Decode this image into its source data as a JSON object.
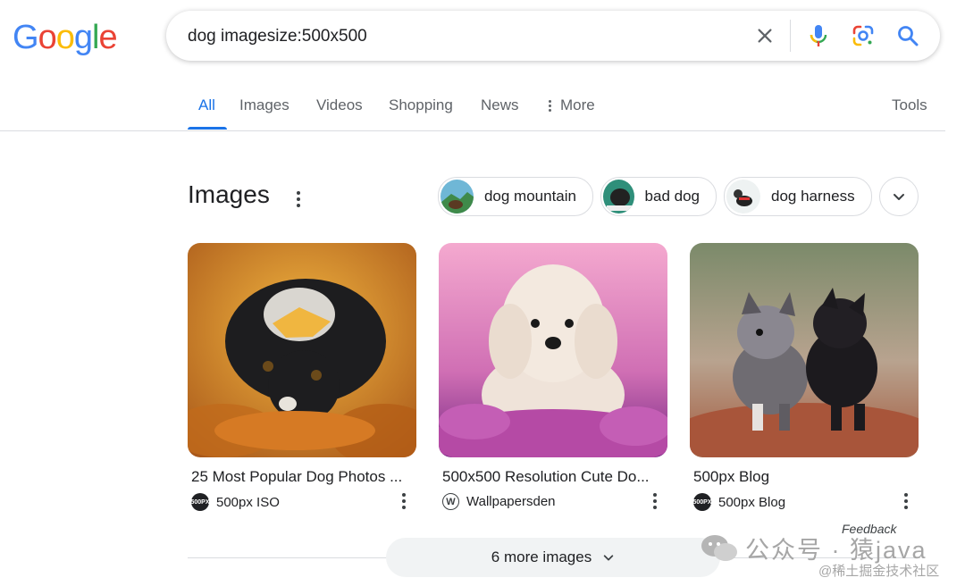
{
  "logo": {
    "letters": [
      "G",
      "o",
      "o",
      "g",
      "l",
      "e"
    ],
    "colors": [
      "#4285F4",
      "#EA4335",
      "#FBBC05",
      "#4285F4",
      "#34A853",
      "#EA4335"
    ]
  },
  "search": {
    "query": "dog imagesize:500x500"
  },
  "tabs": [
    {
      "label": "All",
      "active": true
    },
    {
      "label": "Images"
    },
    {
      "label": "Videos"
    },
    {
      "label": "Shopping"
    },
    {
      "label": "News"
    },
    {
      "label": "More"
    }
  ],
  "tools_label": "Tools",
  "images_section": {
    "title": "Images",
    "chips": [
      {
        "label": "dog mountain"
      },
      {
        "label": "bad dog"
      },
      {
        "label": "dog harness"
      }
    ],
    "results": [
      {
        "title": "25 Most Popular Dog Photos ...",
        "source": "500px ISO",
        "favicon_text": "500PX"
      },
      {
        "title": "500x500 Resolution Cute Do...",
        "source": "Wallpapersden",
        "favicon_text": "W"
      },
      {
        "title": "500px Blog",
        "source": "500px Blog",
        "favicon_text": "500PX"
      }
    ],
    "more_label": "6 more images",
    "feedback_label": "Feedback"
  },
  "watermark": {
    "line1": "公众号 · 猿java",
    "line2": "@稀土掘金技术社区"
  },
  "colors": {
    "accent": "#1a73e8",
    "text": "#202124",
    "muted": "#5f6368"
  }
}
